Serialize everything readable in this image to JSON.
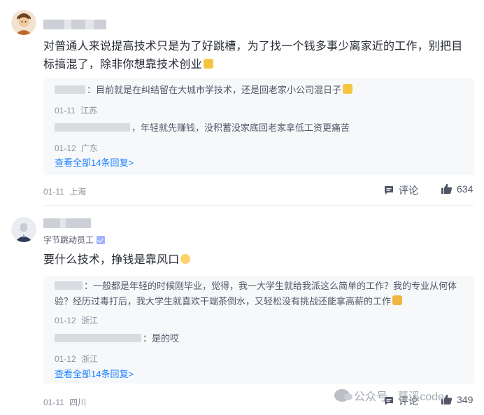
{
  "comments": [
    {
      "text": "对普通人来说提高技术只是为了好跳槽，为了找一个钱多事少离家近的工作，别把目标搞混了，除非你想靠技术创业",
      "replies": [
        {
          "text": "：目前就是在纠结留在大城市学技术，还是回老家小公司混日子",
          "date": "01-11",
          "location": "江苏"
        },
        {
          "text": "，年轻就先赚钱，没积蓄没家底回老家拿低工资更痛苦",
          "date": "01-12",
          "location": "广东"
        }
      ],
      "view_all": "查看全部14条回复>",
      "date": "01-11",
      "location": "上海",
      "comment_label": "评论",
      "likes": "634"
    },
    {
      "badge": "字节跳动员工",
      "text": "要什么技术，挣钱是靠风口",
      "replies": [
        {
          "text": "：一般都是年轻的时候刚毕业，觉得，我一大学生就给我派这么简单的工作？我的专业从何体验？经历过毒打后，我大学生就喜欢干端茶倒水，又轻松没有挑战还能拿高薪的工作",
          "date": "01-12",
          "location": "浙江"
        },
        {
          "text": "：是的哎",
          "date": "01-12",
          "location": "浙江"
        }
      ],
      "view_all": "查看全部14条回复>",
      "date": "01-11",
      "location": "四川",
      "comment_label": "评论",
      "likes": "349"
    }
  ],
  "watermark": "公众号 · 葛溪code",
  "colors": {
    "link": "#1e80ff",
    "meta": "#8a919f",
    "reply_bg": "#f7f8fa"
  }
}
